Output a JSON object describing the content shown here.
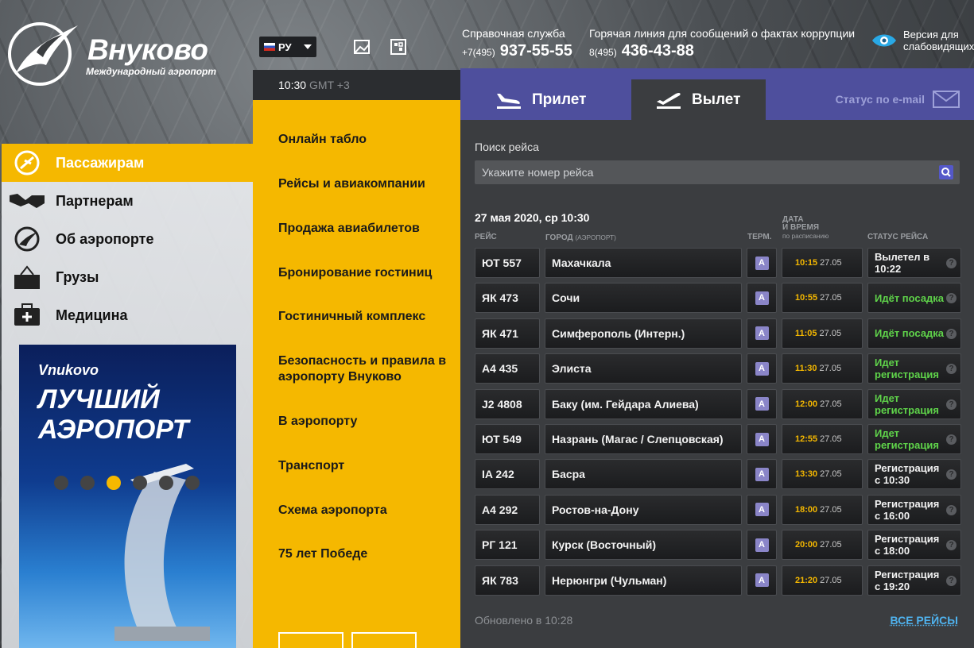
{
  "header": {
    "logo_title": "Внуково",
    "logo_subtitle": "Международный аэропорт",
    "language": "РУ",
    "help_label": "Справочная служба",
    "help_code": "+7(495)",
    "help_phone": "937-55-55",
    "hotline_label": "Горячая линия для сообщений о фактах коррупции",
    "hotline_code": "8(495)",
    "hotline_phone": "436-43-88",
    "vision_label": "Версия для слабовидящих"
  },
  "sidebar": {
    "items": [
      {
        "label": "Пассажирам",
        "icon": "passenger-icon",
        "active": true
      },
      {
        "label": "Партнерам",
        "icon": "handshake-icon",
        "active": false
      },
      {
        "label": "Об аэропорте",
        "icon": "airport-logo-icon",
        "active": false
      },
      {
        "label": "Грузы",
        "icon": "cargo-icon",
        "active": false
      },
      {
        "label": "Медицина",
        "icon": "medical-kit-icon",
        "active": false
      }
    ]
  },
  "banner": {
    "brand": "Vnukovo",
    "title_line1": "ЛУЧШИЙ",
    "title_line2": "АЭРОПОРТ",
    "dots": 6,
    "active_dot": 3
  },
  "menu": {
    "time": "10:30",
    "gmt": "GMT +3",
    "items": [
      "Онлайн табло",
      "Рейсы и авиакомпании",
      "Продажа авиабилетов",
      "Бронирование гостиниц",
      "Гостиничный комплекс",
      "Безопасность и правила в аэропорту Внуково",
      "В аэропорту",
      "Транспорт",
      "Схема аэропорта",
      "75 лет Победе"
    ]
  },
  "board": {
    "tab_arrival": "Прилет",
    "tab_departure": "Вылет",
    "email_status": "Статус по e-mail",
    "search_label": "Поиск рейса",
    "search_placeholder": "Укажите номер рейса",
    "date": "27 мая 2020, ср 10:30",
    "col_flight": "РЕЙС",
    "col_city": "ГОРОД",
    "col_city_sub": "(АЭРОПОРТ)",
    "col_term": "ТЕРМ.",
    "col_time1": "ДАТА",
    "col_time2": "И ВРЕМЯ",
    "col_time_sub": "по расписанию",
    "col_status": "СТАТУС РЕЙСА",
    "flights": [
      {
        "flight": "ЮТ 557",
        "city": "Махачкала",
        "term": "A",
        "time": "10:15",
        "date": "27.05",
        "status": "Вылетел в 10:22",
        "green": false
      },
      {
        "flight": "ЯК 473",
        "city": "Сочи",
        "term": "A",
        "time": "10:55",
        "date": "27.05",
        "status": "Идёт посадка",
        "green": true
      },
      {
        "flight": "ЯК 471",
        "city": "Симферополь (Интерн.)",
        "term": "A",
        "time": "11:05",
        "date": "27.05",
        "status": "Идёт посадка",
        "green": true
      },
      {
        "flight": "А4 435",
        "city": "Элиста",
        "term": "A",
        "time": "11:30",
        "date": "27.05",
        "status": "Идет регистрация",
        "green": true
      },
      {
        "flight": "J2 4808",
        "city": "Баку (им. Гейдара Алиева)",
        "term": "A",
        "time": "12:00",
        "date": "27.05",
        "status": "Идет регистрация",
        "green": true
      },
      {
        "flight": "ЮТ 549",
        "city": "Назрань (Магас / Слепцовская)",
        "term": "A",
        "time": "12:55",
        "date": "27.05",
        "status": "Идет регистрация",
        "green": true
      },
      {
        "flight": "IA 242",
        "city": "Басра",
        "term": "A",
        "time": "13:30",
        "date": "27.05",
        "status": "Регистрация с 10:30",
        "green": false
      },
      {
        "flight": "А4 292",
        "city": "Ростов-на-Дону",
        "term": "A",
        "time": "18:00",
        "date": "27.05",
        "status": "Регистрация с 16:00",
        "green": false
      },
      {
        "flight": "РГ 121",
        "city": "Курск (Восточный)",
        "term": "A",
        "time": "20:00",
        "date": "27.05",
        "status": "Регистрация с 18:00",
        "green": false
      },
      {
        "flight": "ЯК 783",
        "city": "Нерюнгри (Чульман)",
        "term": "A",
        "time": "21:20",
        "date": "27.05",
        "status": "Регистрация с 19:20",
        "green": false
      }
    ],
    "updated": "Обновлено в 10:28",
    "all_flights": "ВСЕ РЕЙСЫ"
  },
  "colors": {
    "accent_yellow": "#f5b800",
    "tab_purple": "#4e4f9d",
    "status_green": "#5fd34a",
    "link_blue": "#4fb3ef"
  }
}
